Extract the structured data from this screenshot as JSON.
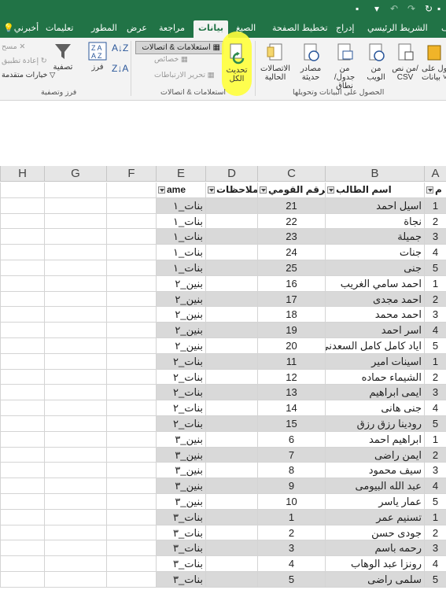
{
  "quick_access": {
    "save_icon": "save-icon",
    "undo_icon": "undo-icon",
    "redo_icon": "redo-icon",
    "customize_icon": "chevron-down-icon"
  },
  "tabs": [
    "الملف",
    "الشريط الرئيسي",
    "إدراج",
    "تخطيط الصفحة",
    "الصيغ",
    "بيانات",
    "مراجعة",
    "عرض",
    "المطور",
    "تعليمات"
  ],
  "tell_me": "أخبرني",
  "active_tab": "بيانات",
  "ribbon": {
    "get_data": {
      "from_text_csv": "من نص/ CSV",
      "from_web": "من الويب",
      "from_table": "من جدول/ نطاق",
      "recent_sources": "مصادر حديثة",
      "existing_connections": "الاتصالات الحالية",
      "get_data_partial": "حول على\nبيانات ˅",
      "group": "الحصول على البيانات وتحويلها"
    },
    "queries": {
      "refresh_all": "تحديث الكل",
      "queries_connections": "استعلامات & اتصالات",
      "properties": "خصائص",
      "edit_links": "تحرير الارتباطات",
      "group": "استعلامات & اتصالات"
    },
    "sort_filter": {
      "sort": "فرز",
      "filter": "تصفية",
      "clear": "مسح",
      "reapply": "إعادة تطبيق",
      "advanced": "خيارات متقدمة",
      "group": "فرز وتصفية"
    }
  },
  "columns": [
    "A",
    "B",
    "C",
    "D",
    "E",
    "F",
    "G",
    "H"
  ],
  "header_row": {
    "A": "م",
    "B": "اسم الطالب",
    "C": "الرقم القومي",
    "D": "ملاحظات",
    "E": "ame"
  },
  "rows": [
    {
      "m": "1",
      "name": "اسيل احمد",
      "id": "21",
      "group": "بنات_١"
    },
    {
      "m": "2",
      "name": "نجاة",
      "id": "22",
      "group": "بنات_١"
    },
    {
      "m": "3",
      "name": "جميلة",
      "id": "23",
      "group": "بنات_١"
    },
    {
      "m": "4",
      "name": "جنات",
      "id": "24",
      "group": "بنات_١"
    },
    {
      "m": "5",
      "name": "جنى",
      "id": "25",
      "group": "بنات_١"
    },
    {
      "m": "1",
      "name": "احمد سامي الغريب",
      "id": "16",
      "group": "بنين_٢"
    },
    {
      "m": "2",
      "name": "احمد مجدى",
      "id": "17",
      "group": "بنين_٢"
    },
    {
      "m": "3",
      "name": "احمد محمد",
      "id": "18",
      "group": "بنين_٢"
    },
    {
      "m": "4",
      "name": "اسر احمد",
      "id": "19",
      "group": "بنين_٢"
    },
    {
      "m": "5",
      "name": "اياد كامل كامل السعدني",
      "id": "20",
      "group": "بنين_٢"
    },
    {
      "m": "1",
      "name": "اسينات امير",
      "id": "11",
      "group": "بنات_٢"
    },
    {
      "m": "2",
      "name": "الشيماء حماده",
      "id": "12",
      "group": "بنات_٢"
    },
    {
      "m": "3",
      "name": "ايمى ابراهيم",
      "id": "13",
      "group": "بنات_٢"
    },
    {
      "m": "4",
      "name": "جنى هانى",
      "id": "14",
      "group": "بنات_٢"
    },
    {
      "m": "5",
      "name": "رودينا رزق رزق",
      "id": "15",
      "group": "بنات_٢"
    },
    {
      "m": "1",
      "name": "ابراهيم احمد",
      "id": "6",
      "group": "بنين_٣"
    },
    {
      "m": "2",
      "name": "ايمن راضى",
      "id": "7",
      "group": "بنين_٣"
    },
    {
      "m": "3",
      "name": "سيف محمود",
      "id": "8",
      "group": "بنين_٣"
    },
    {
      "m": "4",
      "name": "عبد الله البيومى",
      "id": "9",
      "group": "بنين_٣"
    },
    {
      "m": "5",
      "name": "عمار ياسر",
      "id": "10",
      "group": "بنين_٣"
    },
    {
      "m": "1",
      "name": "تسنيم عمر",
      "id": "1",
      "group": "بنات_٣"
    },
    {
      "m": "2",
      "name": "جودى حسن",
      "id": "2",
      "group": "بنات_٣"
    },
    {
      "m": "3",
      "name": "رحمه باسم",
      "id": "3",
      "group": "بنات_٣"
    },
    {
      "m": "4",
      "name": "رونزا عبد الوهاب",
      "id": "4",
      "group": "بنات_٣"
    },
    {
      "m": "5",
      "name": "سلمى راضى",
      "id": "5",
      "group": "بنات_٣"
    }
  ],
  "colors": {
    "excel_green": "#217346",
    "highlight": "#ffff3c",
    "row_shade": "#d9d9d9"
  }
}
